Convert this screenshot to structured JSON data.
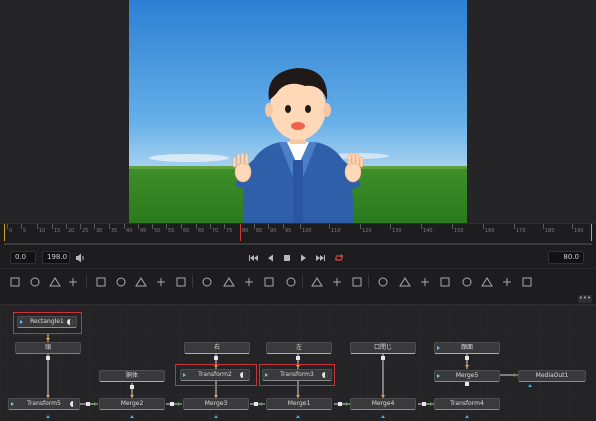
{
  "viewer": {
    "character": "cartoon-man-waving"
  },
  "timeline": {
    "ticks": [
      "0",
      "5",
      "10",
      "15",
      "20",
      "25",
      "30",
      "35",
      "40",
      "45",
      "50",
      "55",
      "60",
      "65",
      "70",
      "75",
      "80",
      "85",
      "90",
      "95",
      "100",
      "110",
      "120",
      "130",
      "140",
      "150",
      "160",
      "170",
      "180",
      "190"
    ],
    "current_frame_value": 80
  },
  "transport": {
    "start": "0.0",
    "end": "198.0",
    "current": "80.0",
    "buttons": [
      "first-frame",
      "step-back",
      "stop",
      "play",
      "last-frame",
      "loop"
    ],
    "loop_active_color": "#e04646"
  },
  "nodes": {
    "rectangle": "Rectangle1",
    "upper": {
      "n1": "頭",
      "n2": "右",
      "n3": "左",
      "n4": "口閉じ",
      "n5": "顔面",
      "n6": "胴体"
    },
    "transform2": "Transform2",
    "transform3": "Transform3",
    "merge5": "Merge5",
    "mediaout": "MediaOut1",
    "bottom": {
      "transform5": "Transform5",
      "merge2": "Merge2",
      "merge3": "Merge3",
      "merge1": "Merge1",
      "merge4": "Merge4",
      "transform4": "Transform4"
    }
  },
  "colors": {
    "mask_node": "#7a8fd0",
    "shape_node": "#5aa04a",
    "image_node": "#e8a630",
    "merge_node": "#8a8a8a",
    "selection": "#c8343a"
  }
}
